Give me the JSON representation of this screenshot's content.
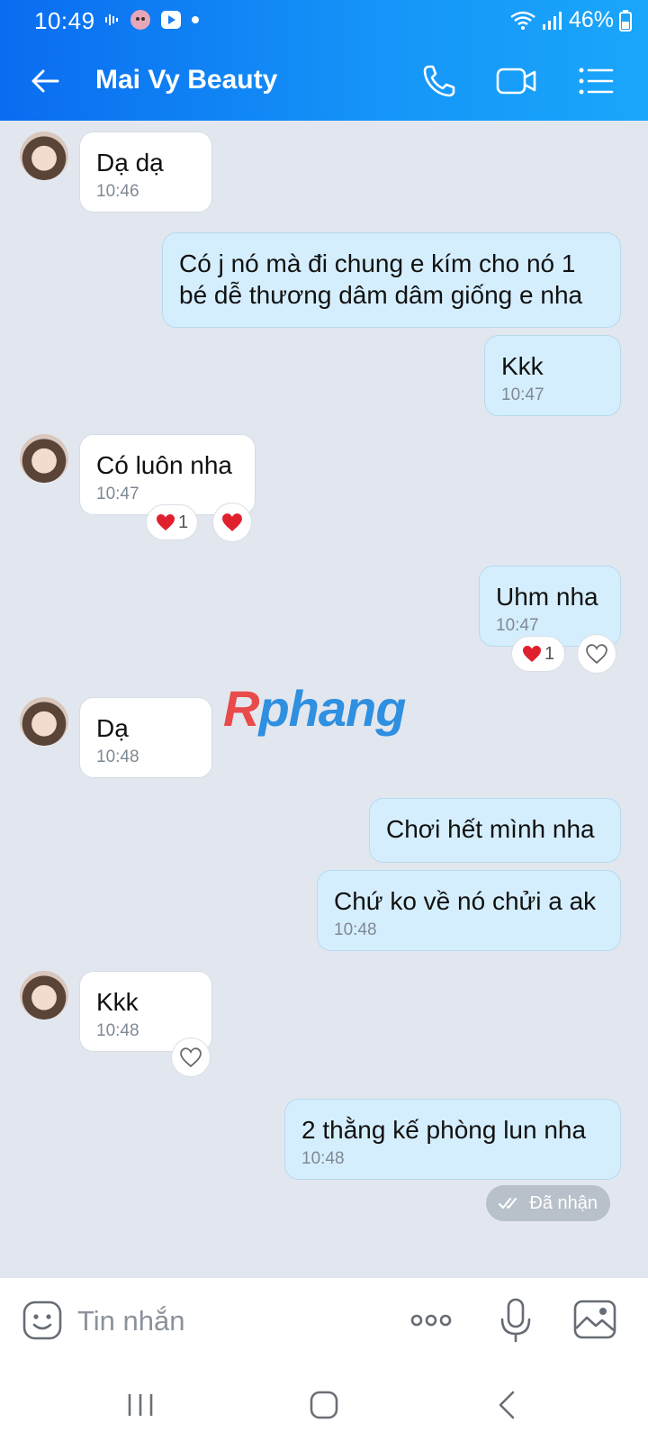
{
  "status_bar": {
    "time": "10:49",
    "battery": "46%"
  },
  "header": {
    "contact_name": "Mai Vy Beauty"
  },
  "messages": [
    {
      "dir": "in",
      "text": "Dạ dạ",
      "time": "10:46"
    },
    {
      "dir": "out",
      "text": "Có j nó mà đi chung e kím cho nó 1\nbé dễ thương dâm dâm giống e nha",
      "time": ""
    },
    {
      "dir": "out",
      "text": "Kkk",
      "time": "10:47"
    },
    {
      "dir": "in",
      "text": "Có luôn nha",
      "time": "10:47",
      "reaction_count": "1"
    },
    {
      "dir": "out",
      "text": "Uhm nha",
      "time": "10:47",
      "reaction_count": "1"
    },
    {
      "dir": "in",
      "text": "Dạ",
      "time": "10:48"
    },
    {
      "dir": "out",
      "text": "Chơi hết mình nha",
      "time": ""
    },
    {
      "dir": "out",
      "text": "Chứ ko về nó chửi a ak",
      "time": "10:48"
    },
    {
      "dir": "in",
      "text": "Kkk",
      "time": "10:48"
    },
    {
      "dir": "out",
      "text": "2 thằng kế phòng lun nha",
      "time": "10:48"
    }
  ],
  "watermark": {
    "part_a": "R",
    "part_b": "phang"
  },
  "delivery_status": "Đã nhận",
  "input": {
    "placeholder": "Tin nhắn"
  },
  "colors": {
    "header_blue": "#0a6cf0",
    "bubble_out": "#d5eefd",
    "chat_bg": "#e2e7ef",
    "heart": "#e0202d"
  },
  "icons": [
    "back-arrow-icon",
    "phone-icon",
    "video-call-icon",
    "list-menu-icon",
    "heart-icon",
    "emoji-icon",
    "more-dots-icon",
    "microphone-icon",
    "image-icon",
    "recent-apps-icon",
    "home-icon",
    "nav-back-icon"
  ]
}
